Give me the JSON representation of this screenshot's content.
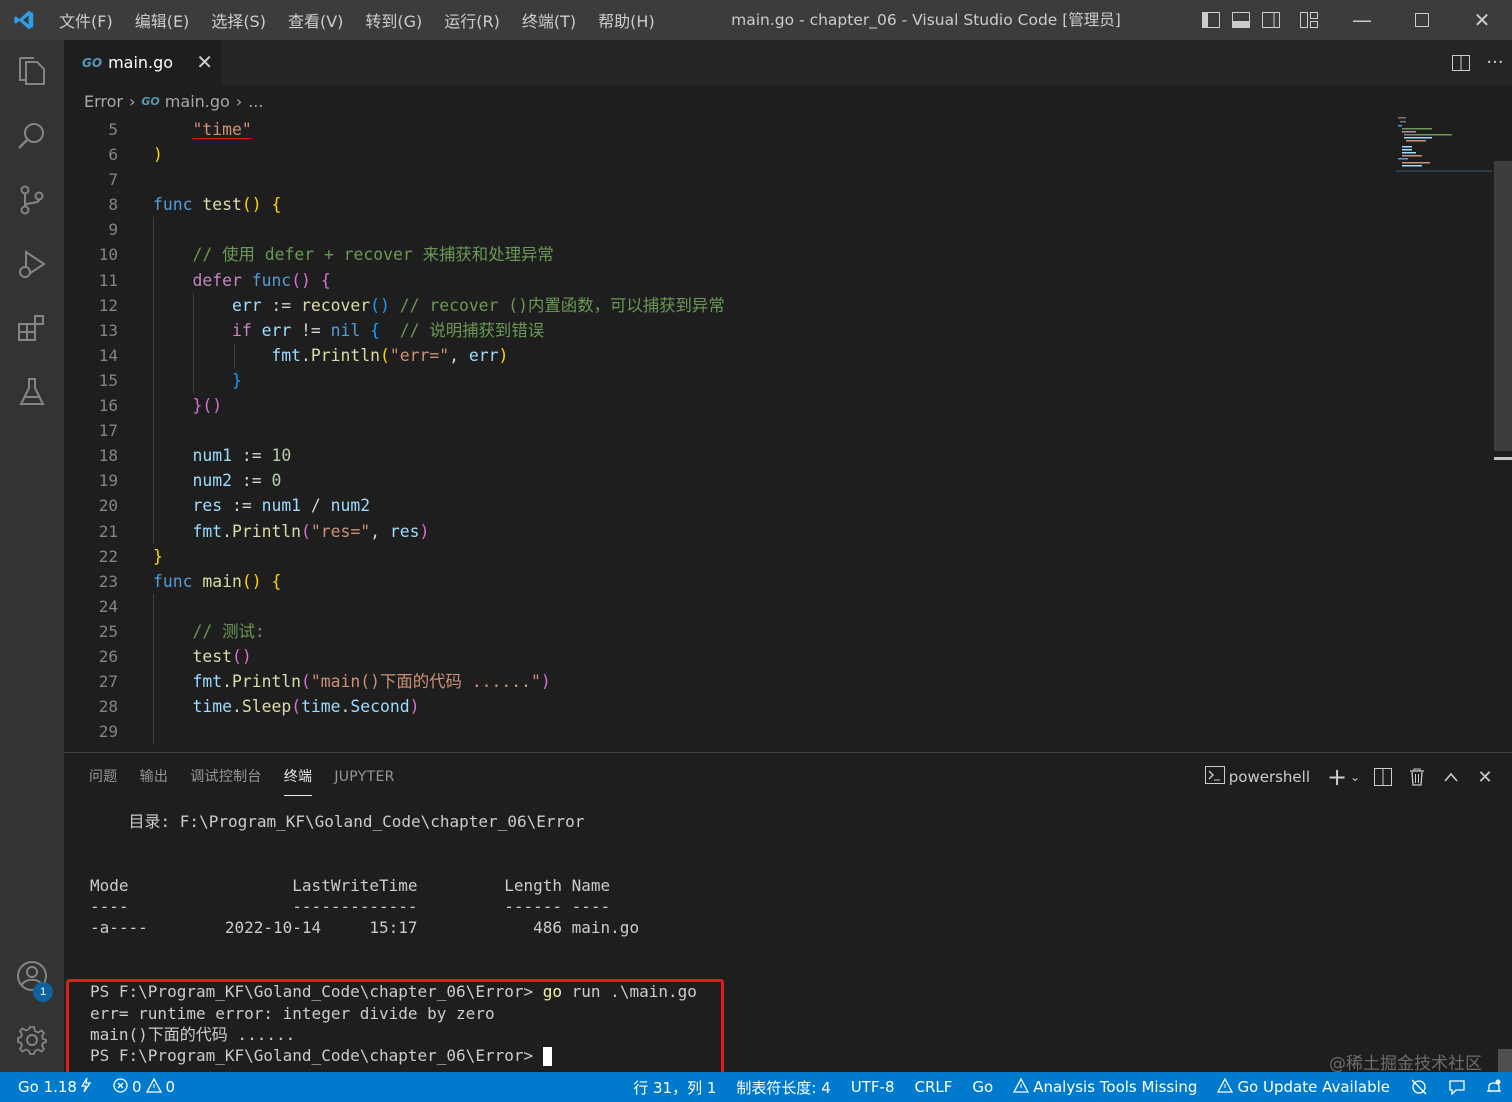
{
  "titlebar": {
    "menu": [
      "文件(F)",
      "编辑(E)",
      "选择(S)",
      "查看(V)",
      "转到(G)",
      "运行(R)",
      "终端(T)",
      "帮助(H)"
    ],
    "window_title": "main.go - chapter_06 - Visual Studio Code [管理员]"
  },
  "tab": {
    "icon": "GO",
    "label": "main.go"
  },
  "breadcrumb": {
    "folder": "Error",
    "icon": "GO",
    "file": "main.go",
    "more": "..."
  },
  "editor": {
    "line_numbers": [
      "5",
      "6",
      "7",
      "8",
      "9",
      "10",
      "11",
      "12",
      "13",
      "14",
      "15",
      "16",
      "17",
      "18",
      "19",
      "20",
      "21",
      "22",
      "23",
      "24",
      "25",
      "26",
      "27",
      "28",
      "29"
    ],
    "code": {
      "l5_str": "\"time\"",
      "l6": ")",
      "l8_kw": "func",
      "l8_fn": "test",
      "l8_rest": "() {",
      "l10_cm": "// 使用 defer + recover 来捕获和处理异常",
      "l11_kw": "defer",
      "l11_kw2": "func",
      "l11_p1": "()",
      "l11_b": "{",
      "l12_var": "err",
      "l12_op": " := ",
      "l12_fn": "recover",
      "l12_p": "()",
      "l12_cm": " // recover ()内置函数，可以捕获到异常",
      "l13_kw": "if",
      "l13_var": "err",
      "l13_op": " != ",
      "l13_nil": "nil",
      "l13_b": "{",
      "l13_cm": "  // 说明捕获到错误",
      "l14_pkg": "fmt",
      "l14_fn": "Println",
      "l14_str": "\"err=\"",
      "l14_var": "err",
      "l15_b": "}",
      "l16_b": "}",
      "l16_p": "()",
      "l18_var": "num1",
      "l18_op": " := ",
      "l18_num": "10",
      "l19_var": "num2",
      "l19_op": " := ",
      "l19_num": "0",
      "l20_var": "res",
      "l20_op": " := ",
      "l20_a": "num1",
      "l20_div": " / ",
      "l20_b": "num2",
      "l21_pkg": "fmt",
      "l21_fn": "Println",
      "l21_str": "\"res=\"",
      "l21_var": "res",
      "l22_b": "}",
      "l23_kw": "func",
      "l23_fn": "main",
      "l23_rest": "() {",
      "l25_cm": "// 测试:",
      "l26_fn": "test",
      "l26_p": "()",
      "l27_pkg": "fmt",
      "l27_fn": "Println",
      "l27_str": "\"main()下面的代码 ......\"",
      "l28_pkg": "time",
      "l28_fn": "Sleep",
      "l28_pkg2": "time",
      "l28_const": "Second"
    }
  },
  "panel": {
    "tabs": [
      "问题",
      "输出",
      "调试控制台",
      "终端",
      "JUPYTER"
    ],
    "active_tab": "终端",
    "shell": "powershell",
    "terminal_lines": [
      "    目录: F:\\Program_KF\\Goland_Code\\chapter_06\\Error",
      "",
      "",
      "Mode                 LastWriteTime         Length Name",
      "----                 -------------         ------ ----",
      "-a----        2022-10-14     15:17            486 main.go",
      "",
      ""
    ],
    "cmd_prompt": "PS F:\\Program_KF\\Goland_Code\\chapter_06\\Error> ",
    "cmd_go": "go",
    "cmd_args": " run .\\main.go",
    "out1": "err= runtime error: integer divide by zero",
    "out2": "main()下面的代码 ......",
    "prompt2": "PS F:\\Program_KF\\Goland_Code\\chapter_06\\Error> ",
    "watermark": "@稀土掘金技术社区"
  },
  "statusbar": {
    "go_version": "Go 1.18",
    "errors": "0",
    "warnings": "0",
    "position": "行 31，列 1",
    "tab_size": "制表符长度: 4",
    "encoding": "UTF-8",
    "eol": "CRLF",
    "language": "Go",
    "analysis": "Analysis Tools Missing",
    "update": "Go Update Available"
  },
  "accounts_badge": "1",
  "colors": {
    "statusbar": "#007acc",
    "activitybar": "#333333",
    "editor_bg": "#1e1e1e",
    "highlight_box": "#e0191a"
  }
}
